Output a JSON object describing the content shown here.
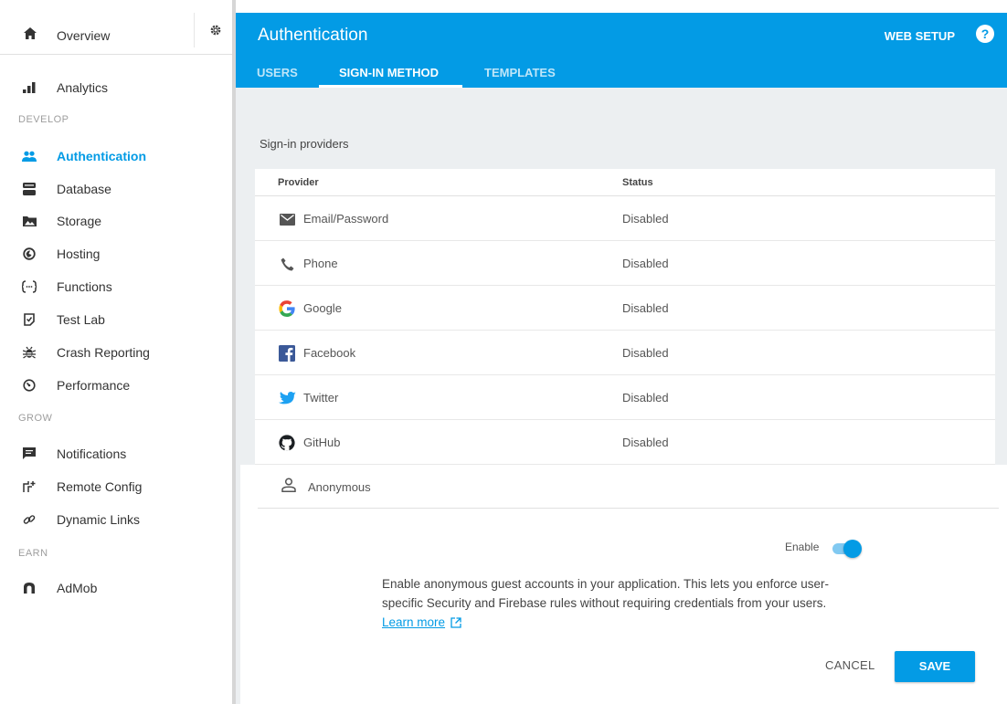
{
  "sidebar": {
    "overview_label": "Overview",
    "analytics_label": "Analytics",
    "sections": {
      "develop": "DEVELOP",
      "grow": "GROW",
      "earn": "EARN"
    },
    "develop_items": [
      {
        "label": "Authentication",
        "icon": "people-icon"
      },
      {
        "label": "Database",
        "icon": "database-icon"
      },
      {
        "label": "Storage",
        "icon": "storage-icon"
      },
      {
        "label": "Hosting",
        "icon": "hosting-icon"
      },
      {
        "label": "Functions",
        "icon": "functions-icon"
      },
      {
        "label": "Test Lab",
        "icon": "test-lab-icon"
      },
      {
        "label": "Crash Reporting",
        "icon": "bug-icon"
      },
      {
        "label": "Performance",
        "icon": "performance-icon"
      }
    ],
    "grow_items": [
      {
        "label": "Notifications",
        "icon": "notifications-icon"
      },
      {
        "label": "Remote Config",
        "icon": "remote-config-icon"
      },
      {
        "label": "Dynamic Links",
        "icon": "link-icon"
      }
    ],
    "earn_items": [
      {
        "label": "AdMob",
        "icon": "admob-icon"
      }
    ]
  },
  "header": {
    "title": "Authentication",
    "web_setup": "WEB SETUP",
    "help": "?",
    "tabs": [
      "USERS",
      "SIGN-IN METHOD",
      "TEMPLATES"
    ]
  },
  "main": {
    "providers_title": "Sign-in providers",
    "columns": [
      "Provider",
      "Status"
    ],
    "providers": [
      {
        "name": "Email/Password",
        "status": "Disabled",
        "icon": "email-icon"
      },
      {
        "name": "Phone",
        "status": "Disabled",
        "icon": "phone-icon"
      },
      {
        "name": "Google",
        "status": "Disabled",
        "icon": "google-icon"
      },
      {
        "name": "Facebook",
        "status": "Disabled",
        "icon": "facebook-icon"
      },
      {
        "name": "Twitter",
        "status": "Disabled",
        "icon": "twitter-icon"
      },
      {
        "name": "GitHub",
        "status": "Disabled",
        "icon": "github-icon"
      }
    ],
    "expanded": {
      "name": "Anonymous",
      "icon": "person-icon",
      "enable_label": "Enable",
      "enabled": true,
      "description": "Enable anonymous guest accounts in your application. This lets you enforce user-specific Security and Firebase rules without requiring credentials from your users.",
      "learn_more": "Learn more",
      "cancel": "CANCEL",
      "save": "SAVE"
    }
  },
  "colors": {
    "accent": "#039be5",
    "background": "#eceff1"
  }
}
